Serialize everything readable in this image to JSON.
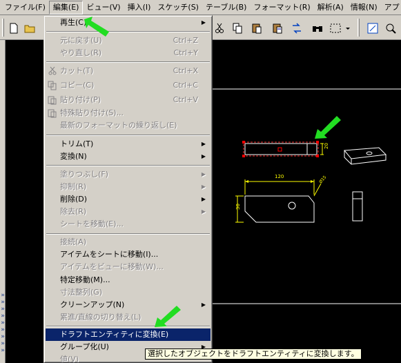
{
  "menubar": {
    "items": [
      "ファイル(F)",
      "編集(E)",
      "ビュー(V)",
      "挿入(I)",
      "スケッチ(S)",
      "テーブル(B)",
      "フォーマット(R)",
      "解析(A)",
      "情報(N)",
      "アプリケーシ"
    ]
  },
  "edit_menu": {
    "items": [
      {
        "label": "再生(C)",
        "shortcut": "",
        "enabled": true,
        "submenu": true
      },
      {
        "label": "元に戻す(U)",
        "shortcut": "Ctrl+Z",
        "enabled": false
      },
      {
        "label": "やり直し(R)",
        "shortcut": "Ctrl+Y",
        "enabled": false
      },
      {
        "label": "カット(T)",
        "shortcut": "Ctrl+X",
        "enabled": false,
        "icon": "scissors-icon"
      },
      {
        "label": "コピー(C)",
        "shortcut": "Ctrl+C",
        "enabled": false,
        "icon": "copy-icon"
      },
      {
        "label": "貼り付け(P)",
        "shortcut": "Ctrl+V",
        "enabled": false,
        "icon": "paste-icon"
      },
      {
        "label": "特殊貼り付け(S)...",
        "shortcut": "",
        "enabled": false,
        "icon": "paste-special-icon"
      },
      {
        "label": "最新のフォーマットの繰り返し(E)",
        "shortcut": "",
        "enabled": false
      },
      {
        "label": "トリム(T)",
        "enabled": true,
        "submenu": true
      },
      {
        "label": "変換(N)",
        "enabled": true,
        "submenu": true
      },
      {
        "label": "塗りつぶし(F)",
        "enabled": false,
        "submenu": true
      },
      {
        "label": "抑制(R)",
        "enabled": false,
        "submenu": true
      },
      {
        "label": "削除(D)",
        "enabled": true,
        "submenu": true
      },
      {
        "label": "除去(R)",
        "enabled": false,
        "submenu": true
      },
      {
        "label": "シートを移動(E)...",
        "enabled": false
      },
      {
        "label": "接続(A)",
        "enabled": false
      },
      {
        "label": "アイテムをシートに移動(I)...",
        "enabled": true
      },
      {
        "label": "アイテムをビューに移動(W)...",
        "enabled": false
      },
      {
        "label": "特定移動(M)...",
        "enabled": true
      },
      {
        "label": "寸法整列(G)",
        "enabled": false
      },
      {
        "label": "クリーンアップ(N)",
        "enabled": true,
        "submenu": true
      },
      {
        "label": "累進/直線の切り替え(L)",
        "enabled": false
      },
      {
        "label": "ドラフトエンティティに変換(E)",
        "enabled": true,
        "highlighted": true
      },
      {
        "label": "グループ化(U)",
        "enabled": true,
        "submenu": true
      },
      {
        "label": "値(V)",
        "enabled": false
      }
    ]
  },
  "tooltip": "選択したオブジェクトをドラフトエンティティに変換します。",
  "drawing": {
    "dim_width": "120",
    "dim_height": "30",
    "dim_small": "20",
    "dim_radius": "Ø15"
  },
  "colors": {
    "menu_highlight": "#0a246a",
    "annotation_arrow": "#22dd22",
    "dimension": "#ffff00",
    "selection": "#ff0000"
  }
}
